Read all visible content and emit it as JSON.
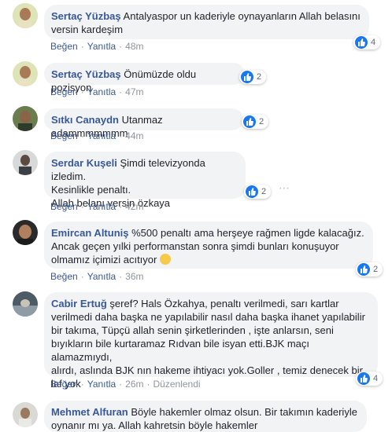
{
  "labels": {
    "like": "Beğen",
    "reply": "Yanıtla",
    "dot": "·",
    "edited": "Düzenlendi"
  },
  "colors": {
    "author": "#385898",
    "bubble": "#f2f3f5",
    "like_blue": "#1877f2",
    "meta": "#90949c"
  },
  "comments": [
    {
      "author": "Sertaç Yüzbaş",
      "text_line1": "Antalyaspor un kaderiyle oynayanların Allah belasını",
      "text_line2": "versin kardeşim",
      "reactions": "4",
      "time": "48m"
    },
    {
      "author": "Sertaç Yüzbaş",
      "text": "Önümüzde oldu pozisyon",
      "reactions": "2",
      "time": "47m"
    },
    {
      "author": "Sıtkı Canaydn",
      "text": "Utanmaz adammmmmmm",
      "reactions": "2",
      "time": "44m"
    },
    {
      "author": "Serdar Kuşeli",
      "text_line1": "Şimdi televizyonda izledim.",
      "text_line2": "Kesinlikle penaltı.",
      "text_line3": "Allah belanı versin özkaya",
      "reactions": "2",
      "time": "42m"
    },
    {
      "author": "Emircan Altuniş",
      "text_line1": "%500 penaltı ama herşeye rağmen ligde kalacağız.",
      "text_line2": "Ancak geçen yılki performanstan sonra şimdi bunları konuşuyor",
      "text_line3": "olmamız içimizi acıtıyor",
      "reactions": "2",
      "time": "36m"
    },
    {
      "author": "Cabir Ertuğ",
      "text_line1": "şeref? Hals Özkahya, penaltı verilmedi, sarı kartlar",
      "text_line2": "verilmedi daha başka ne yapılabilir nasıl daha başka ihanet yapılabilir",
      "text_line3": "bir takıma, Tüpçü allah senin şirketlerinden , işte anlarsın, seni",
      "text_line4": "bıyıkların bile kurtaramaz Rıdvan bile isyan etti.BJK maçı alamazmıydı,",
      "text_line5": "alırdı, aslında BJK nın hakeme ihtiyacı yok.Goller , temiz denecek bir",
      "text_line6": "laf yok",
      "reactions": "4",
      "time": "26m"
    },
    {
      "author": "Mehmet Alfuran",
      "text_line1": "Böyle hakemler olmaz olsun. Bir takımın kaderiyle",
      "text_line2": "oynanır mı ya. Allah kahretsin böyle hakemler"
    }
  ]
}
